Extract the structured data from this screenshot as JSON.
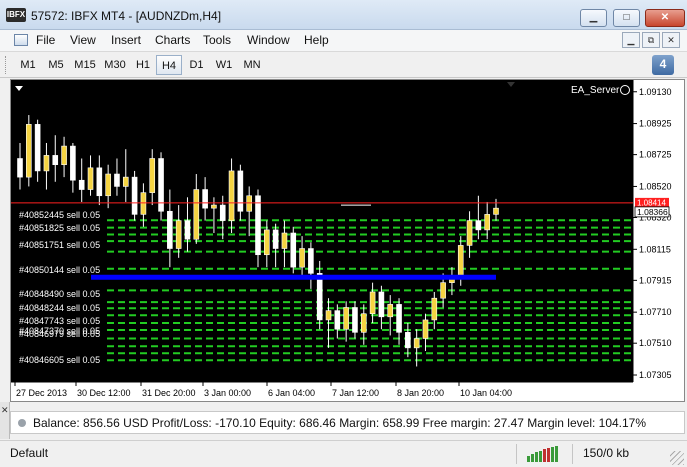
{
  "window": {
    "logo_text": "IBFX",
    "title": "57572: IBFX MT4 - [AUDNZDm,H4]",
    "min_icon": "minimize-icon",
    "max_icon": "maximize-icon",
    "close_icon": "close-icon"
  },
  "menu": {
    "items": [
      "File",
      "View",
      "Insert",
      "Charts",
      "Tools",
      "Window",
      "Help"
    ],
    "mdi_icons": [
      "mdi-minimize-icon",
      "mdi-restore-icon",
      "mdi-close-icon"
    ]
  },
  "timeframes": {
    "items": [
      "M1",
      "M5",
      "M15",
      "M30",
      "H1",
      "H4",
      "D1",
      "W1",
      "MN"
    ],
    "active": "H4",
    "notification_count": "4"
  },
  "chart": {
    "expert_label": "EA_Server",
    "background_color": "#000000",
    "bull_color": "#f5d442",
    "bear_color": "#ffffff",
    "level_line_color": "#22cc22",
    "blue_line_color": "#0000ff",
    "red_line_color": "#ff2020",
    "ask_label": "1.08414",
    "bid_label": "1.08366",
    "chart_data": {
      "type": "candlestick",
      "symbol": "AUDNZDm",
      "timeframe": "H4",
      "y_ticks": [
        "1.09130",
        "1.08925",
        "1.08725",
        "1.08520",
        "1.08320",
        "1.08115",
        "1.07915",
        "1.07710",
        "1.07510",
        "1.07305"
      ],
      "x_ticks": [
        "27 Dec 2013",
        "30 Dec 12:00",
        "31 Dec 20:00",
        "3 Jan 00:00",
        "6 Jan 04:00",
        "7 Jan 12:00",
        "8 Jan 20:00",
        "10 Jan 04:00"
      ],
      "order_labels": [
        "#40852445 sell 0.05",
        "#40851825 sell 0.05",
        "#40851751 sell 0.05",
        "#40850144 sell 0.05",
        "#40848490 sell 0.05",
        "#40848244 sell 0.05",
        "#40847743 sell 0.05",
        "#40847370 sell 0.05",
        "#40846979 sell 0.05",
        "#40846605 sell 0.05"
      ],
      "candles": [
        {
          "o": 1.087,
          "h": 1.088,
          "l": 1.085,
          "c": 1.0858
        },
        {
          "o": 1.0858,
          "h": 1.0898,
          "l": 1.0852,
          "c": 1.0892
        },
        {
          "o": 1.0892,
          "h": 1.0895,
          "l": 1.0855,
          "c": 1.0862
        },
        {
          "o": 1.0862,
          "h": 1.088,
          "l": 1.085,
          "c": 1.0872
        },
        {
          "o": 1.0872,
          "h": 1.0885,
          "l": 1.0855,
          "c": 1.0866
        },
        {
          "o": 1.0866,
          "h": 1.0884,
          "l": 1.0858,
          "c": 1.0878
        },
        {
          "o": 1.0878,
          "h": 1.088,
          "l": 1.0848,
          "c": 1.0856
        },
        {
          "o": 1.0856,
          "h": 1.087,
          "l": 1.0842,
          "c": 1.085
        },
        {
          "o": 1.085,
          "h": 1.0872,
          "l": 1.0846,
          "c": 1.0864
        },
        {
          "o": 1.0864,
          "h": 1.0872,
          "l": 1.084,
          "c": 1.0846
        },
        {
          "o": 1.0846,
          "h": 1.0866,
          "l": 1.0838,
          "c": 1.086
        },
        {
          "o": 1.086,
          "h": 1.087,
          "l": 1.0846,
          "c": 1.0852
        },
        {
          "o": 1.0852,
          "h": 1.0876,
          "l": 1.0842,
          "c": 1.0858
        },
        {
          "o": 1.0858,
          "h": 1.0862,
          "l": 1.083,
          "c": 1.0834
        },
        {
          "o": 1.0834,
          "h": 1.0854,
          "l": 1.0826,
          "c": 1.0848
        },
        {
          "o": 1.0848,
          "h": 1.0876,
          "l": 1.084,
          "c": 1.087
        },
        {
          "o": 1.087,
          "h": 1.0874,
          "l": 1.083,
          "c": 1.0836
        },
        {
          "o": 1.0836,
          "h": 1.085,
          "l": 1.08,
          "c": 1.0812
        },
        {
          "o": 1.0812,
          "h": 1.084,
          "l": 1.0806,
          "c": 1.083
        },
        {
          "o": 1.083,
          "h": 1.0845,
          "l": 1.081,
          "c": 1.0818
        },
        {
          "o": 1.0818,
          "h": 1.086,
          "l": 1.0815,
          "c": 1.085
        },
        {
          "o": 1.085,
          "h": 1.0858,
          "l": 1.083,
          "c": 1.0838
        },
        {
          "o": 1.0838,
          "h": 1.0845,
          "l": 1.0822,
          "c": 1.084
        },
        {
          "o": 1.084,
          "h": 1.0846,
          "l": 1.0818,
          "c": 1.083
        },
        {
          "o": 1.083,
          "h": 1.087,
          "l": 1.0822,
          "c": 1.0862
        },
        {
          "o": 1.0862,
          "h": 1.0866,
          "l": 1.083,
          "c": 1.0836
        },
        {
          "o": 1.0836,
          "h": 1.0852,
          "l": 1.082,
          "c": 1.0846
        },
        {
          "o": 1.0846,
          "h": 1.085,
          "l": 1.08,
          "c": 1.0808
        },
        {
          "o": 1.0808,
          "h": 1.083,
          "l": 1.08,
          "c": 1.0824
        },
        {
          "o": 1.0824,
          "h": 1.0828,
          "l": 1.08,
          "c": 1.0812
        },
        {
          "o": 1.0812,
          "h": 1.083,
          "l": 1.08,
          "c": 1.0822
        },
        {
          "o": 1.0822,
          "h": 1.0826,
          "l": 1.0796,
          "c": 1.08
        },
        {
          "o": 1.08,
          "h": 1.082,
          "l": 1.0795,
          "c": 1.0812
        },
        {
          "o": 1.0812,
          "h": 1.0816,
          "l": 1.0786,
          "c": 1.0796
        },
        {
          "o": 1.0796,
          "h": 1.0804,
          "l": 1.076,
          "c": 1.0766
        },
        {
          "o": 1.0766,
          "h": 1.078,
          "l": 1.0748,
          "c": 1.0772
        },
        {
          "o": 1.0772,
          "h": 1.0776,
          "l": 1.0754,
          "c": 1.076
        },
        {
          "o": 1.076,
          "h": 1.0778,
          "l": 1.0752,
          "c": 1.0774
        },
        {
          "o": 1.0774,
          "h": 1.0778,
          "l": 1.0754,
          "c": 1.0758
        },
        {
          "o": 1.0758,
          "h": 1.0776,
          "l": 1.075,
          "c": 1.077
        },
        {
          "o": 1.077,
          "h": 1.079,
          "l": 1.0764,
          "c": 1.0784
        },
        {
          "o": 1.0784,
          "h": 1.0788,
          "l": 1.076,
          "c": 1.0768
        },
        {
          "o": 1.0768,
          "h": 1.0782,
          "l": 1.0756,
          "c": 1.0776
        },
        {
          "o": 1.0776,
          "h": 1.078,
          "l": 1.075,
          "c": 1.0758
        },
        {
          "o": 1.0758,
          "h": 1.0764,
          "l": 1.0742,
          "c": 1.0748
        },
        {
          "o": 1.0748,
          "h": 1.076,
          "l": 1.0736,
          "c": 1.0754
        },
        {
          "o": 1.0754,
          "h": 1.077,
          "l": 1.0746,
          "c": 1.0766
        },
        {
          "o": 1.0766,
          "h": 1.0784,
          "l": 1.076,
          "c": 1.078
        },
        {
          "o": 1.078,
          "h": 1.0796,
          "l": 1.0774,
          "c": 1.079
        },
        {
          "o": 1.079,
          "h": 1.08,
          "l": 1.0782,
          "c": 1.0794
        },
        {
          "o": 1.0794,
          "h": 1.082,
          "l": 1.0788,
          "c": 1.0814
        },
        {
          "o": 1.0814,
          "h": 1.0836,
          "l": 1.0806,
          "c": 1.083
        },
        {
          "o": 1.083,
          "h": 1.0846,
          "l": 1.0818,
          "c": 1.0824
        },
        {
          "o": 1.0824,
          "h": 1.0842,
          "l": 1.0818,
          "c": 1.0834
        },
        {
          "o": 1.0834,
          "h": 1.0844,
          "l": 1.083,
          "c": 1.0838
        }
      ],
      "blue_line_price": 1.07935,
      "red_line_price": 1.08414,
      "level_prices": [
        1.08302,
        1.08255,
        1.0821,
        1.08168,
        1.081,
        1.0799,
        1.0785,
        1.07775,
        1.07735,
        1.0769,
        1.0764,
        1.07595,
        1.0754,
        1.0749,
        1.07445,
        1.074
      ],
      "ylim": [
        1.0726,
        1.0918
      ]
    }
  },
  "terminal": {
    "close_icon": "close-icon",
    "account": "Balance: 856.56 USD  Profit/Loss: -170.10  Equity: 686.46  Margin: 658.99  Free margin: 27.47  Margin level: 104.17%"
  },
  "status": {
    "profile": "Default",
    "traffic": "150/0 kb",
    "connection_icon": "connection-bars-icon"
  }
}
